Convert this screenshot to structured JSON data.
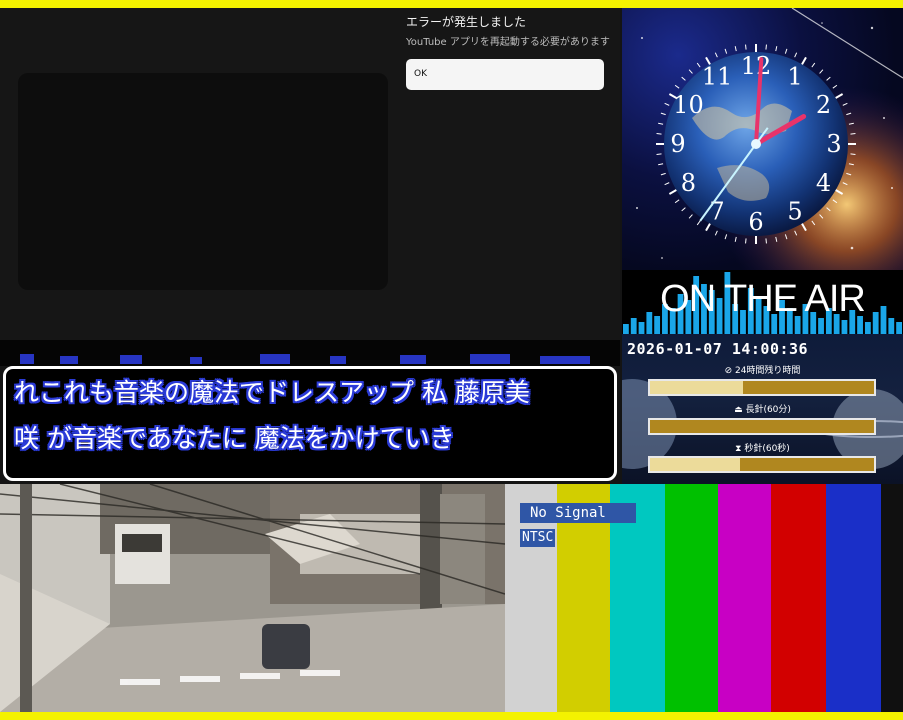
{
  "error_dialog": {
    "title": "エラーが発生しました",
    "message": "YouTube アプリを再起動する必要があります",
    "ok_label": "OK"
  },
  "clock": {
    "numerals": [
      "12",
      "1",
      "2",
      "3",
      "4",
      "5",
      "6",
      "7",
      "8",
      "9",
      "10",
      "11"
    ],
    "time": "14:00:36"
  },
  "onair": {
    "text": "ON THE AIR"
  },
  "timer": {
    "datetime": "2026-01-07 14:00:36",
    "labels": [
      "24時間残り時間",
      "長針(60分)",
      "秒針(60秒)"
    ],
    "progress": [
      0.415,
      0.0,
      0.4
    ]
  },
  "lyrics": {
    "line1": "れこれも音楽の魔法でドレスアップ 私 藤原美",
    "line2": "咲 が音楽であなたに 魔法をかけていき"
  },
  "color_bars": {
    "no_signal": "No Signal",
    "standard": "NTSC",
    "colors": [
      "#d2d2d2",
      "#d2ce00",
      "#00c8c0",
      "#00c000",
      "#c800c4",
      "#d20000",
      "#1a2fc8",
      "#101010"
    ]
  },
  "colors": {
    "frame": "#f4f200",
    "lyric_outline": "#2b3bd8",
    "onair_bars": "#1aa6e8"
  }
}
